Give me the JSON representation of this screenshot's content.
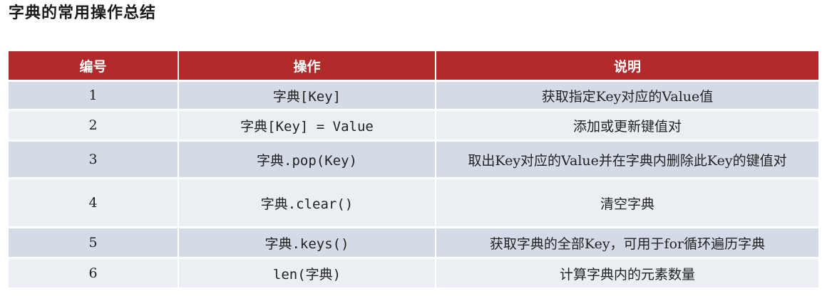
{
  "title": "字典的常用操作总结",
  "table": {
    "headers": [
      "编号",
      "操作",
      "说明"
    ],
    "rows": [
      {
        "no": "1",
        "op": "字典[Key]",
        "desc": "获取指定Key对应的Value值"
      },
      {
        "no": "2",
        "op": "字典[Key] = Value",
        "desc": "添加或更新键值对"
      },
      {
        "no": "3",
        "op": "字典.pop(Key)",
        "desc": "取出Key对应的Value并在字典内删除此Key的键值对"
      },
      {
        "no": "4",
        "op": "字典.clear()",
        "desc": "清空字典"
      },
      {
        "no": "5",
        "op": "字典.keys()",
        "desc": "获取字典的全部Key，可用于for循环遍历字典"
      },
      {
        "no": "6",
        "op": "len(字典)",
        "desc": "计算字典内的元素数量"
      }
    ]
  },
  "colors": {
    "header_bg": "#b22a2a",
    "row_dark": "#d5dbe6",
    "row_light": "#ebeef3"
  }
}
